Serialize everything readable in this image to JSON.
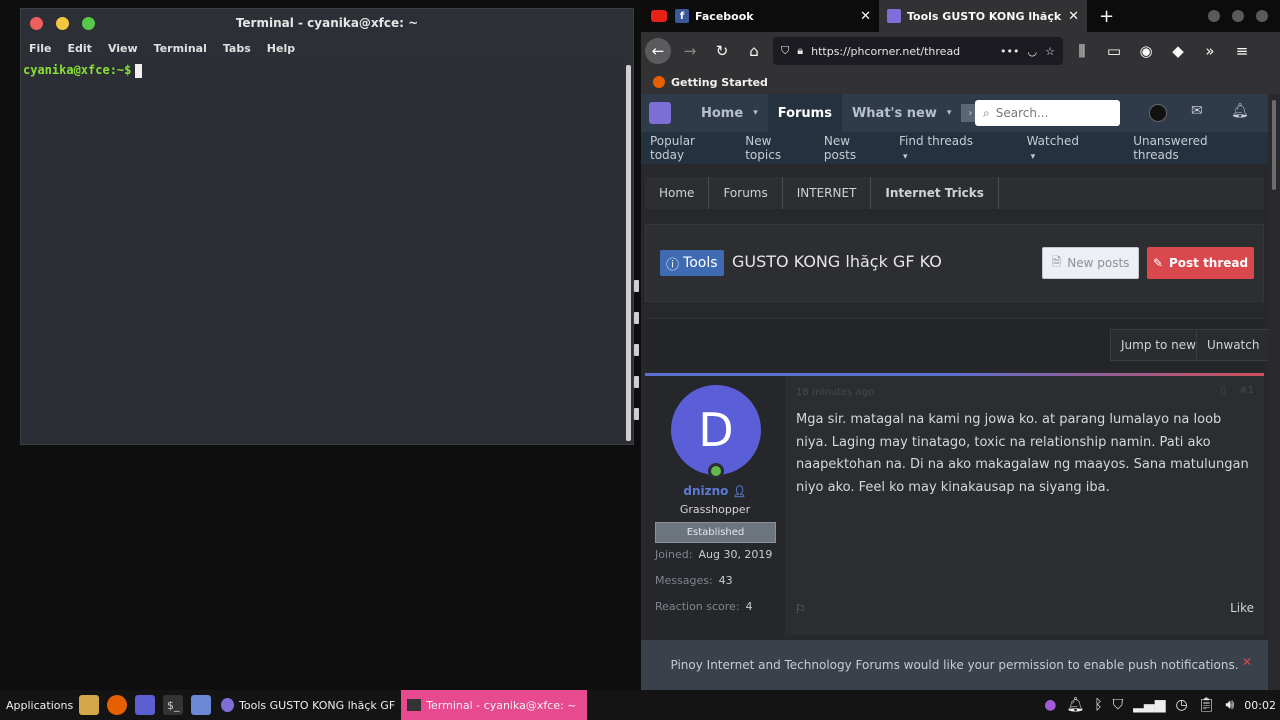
{
  "terminal": {
    "title": "Terminal - cyanika@xfce: ~",
    "menu": [
      "File",
      "Edit",
      "View",
      "Terminal",
      "Tabs",
      "Help"
    ],
    "prompt": "cyanika@xfce:~$"
  },
  "browser": {
    "tabs": [
      {
        "label": "Facebook"
      },
      {
        "label": "Tools GUSTO KONG lhăçk GF K"
      }
    ],
    "new_tab": "+",
    "url": "https://phcorner.net/thread",
    "bookmark": "Getting Started"
  },
  "site": {
    "nav": [
      "Home",
      "Forums",
      "What's new"
    ],
    "search_placeholder": "Search...",
    "subnav": [
      "Popular today",
      "New topics",
      "New posts",
      "Find threads",
      "Watched",
      "Unanswered threads"
    ],
    "breadcrumbs": [
      "Home",
      "Forums",
      "INTERNET",
      "Internet Tricks"
    ],
    "thread": {
      "prefix": "Tools",
      "title": "GUSTO KONG lhăçk GF KO",
      "new_posts": "New posts",
      "post_thread": "Post thread",
      "jump": "Jump to new",
      "unwatch": "Unwatch"
    },
    "post": {
      "meta": "18 minutes ago",
      "num": "#1",
      "avatar_letter": "D",
      "username": "dnizno",
      "user_title": "Grasshopper",
      "banner": "Established",
      "joined_label": "Joined:",
      "joined": "Aug 30, 2019",
      "messages_label": "Messages:",
      "messages": "43",
      "reaction_label": "Reaction score:",
      "reaction": "4",
      "body": "Mga sir. matagal na kami ng jowa ko. at parang lumalayo na loob niya. Laging may tinatago, toxic na relationship namin. Pati ako naapektohan na. Di na ako makagalaw ng maayos. Sana matulungan niyo ako. Feel ko may kinakausap na siyang iba.",
      "like": "Like"
    },
    "notice": "Pinoy Internet and Technology Forums would like your permission to enable push notifications."
  },
  "taskbar": {
    "applications": "Applications",
    "tasks": [
      "Tools GUSTO KONG lhăçk GF ...",
      "Terminal - cyanika@xfce: ~"
    ],
    "clock": "00:02"
  },
  "colors": {
    "accent": "#3f6bb3",
    "post_btn": "#d9484c",
    "terminal_task": "#e84a8f"
  }
}
